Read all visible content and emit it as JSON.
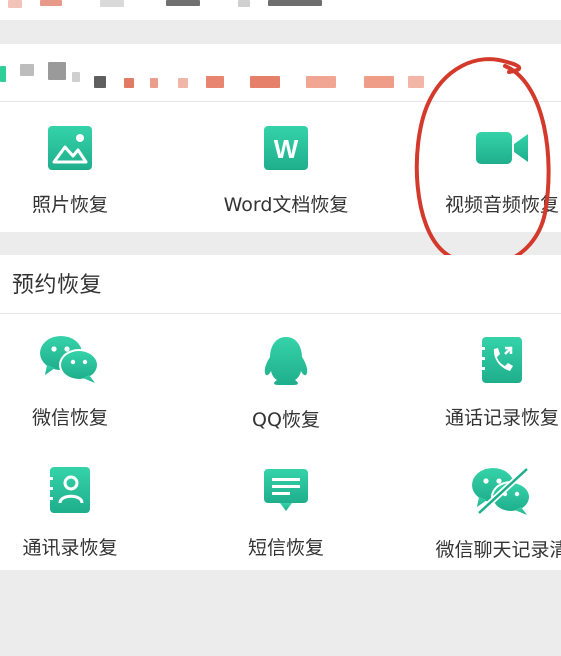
{
  "colors": {
    "accent": "#2ec4a0",
    "accent_dark": "#1fae8c",
    "annotation": "#d33a2c"
  },
  "features_top": [
    {
      "label": "照片恢复",
      "icon": "image-icon"
    },
    {
      "label": "Word文档恢复",
      "icon": "word-doc-icon"
    },
    {
      "label": "视频音频恢复",
      "icon": "video-camera-icon"
    }
  ],
  "reservation": {
    "title": "预约恢复",
    "items": [
      {
        "label": "微信恢复",
        "icon": "wechat-icon"
      },
      {
        "label": "QQ恢复",
        "icon": "qq-penguin-icon"
      },
      {
        "label": "通话记录恢复",
        "icon": "phone-book-icon"
      },
      {
        "label": "通讯录恢复",
        "icon": "contact-book-icon"
      },
      {
        "label": "短信恢复",
        "icon": "sms-message-icon"
      },
      {
        "label": "微信聊天记录清",
        "icon": "wechat-clear-icon"
      }
    ]
  }
}
